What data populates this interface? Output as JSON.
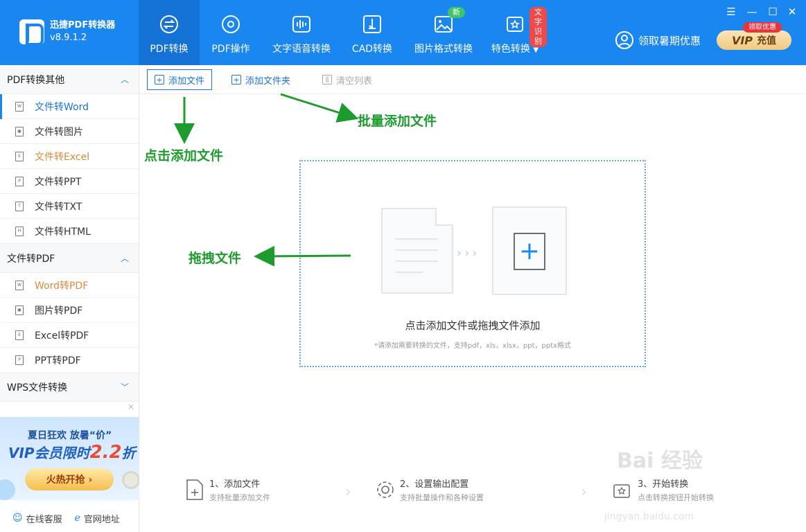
{
  "brand": {
    "name": "迅捷PDF转换器",
    "version": "v8.9.1.2"
  },
  "nav_tabs": [
    {
      "label": "PDF转换",
      "icon": "convert-icon"
    },
    {
      "label": "PDF操作",
      "icon": "settings-icon"
    },
    {
      "label": "文字语音转换",
      "icon": "audio-wave-icon"
    },
    {
      "label": "CAD转换",
      "icon": "cad-icon"
    },
    {
      "label": "图片格式转换",
      "icon": "image-icon",
      "badge": "新"
    },
    {
      "label": "特色转换",
      "icon": "special-icon",
      "badge": "文字识别"
    }
  ],
  "header": {
    "promo_label": "领取暑期优惠",
    "vip_tag": "领取优惠",
    "vip_word": "VIP",
    "vip_recharge": "充值"
  },
  "window_controls": {
    "menu": "☰",
    "minimize": "—",
    "maximize": "☐",
    "close": "✕"
  },
  "sidebar": {
    "groups": [
      {
        "title": "PDF转换其他",
        "expanded": true,
        "items": [
          {
            "label": "文件转Word",
            "glyph": "W",
            "state": "active"
          },
          {
            "label": "文件转图片",
            "glyph": "▣",
            "state": ""
          },
          {
            "label": "文件转Excel",
            "glyph": "E",
            "state": "orange"
          },
          {
            "label": "文件转PPT",
            "glyph": "P",
            "state": ""
          },
          {
            "label": "文件转TXT",
            "glyph": "T",
            "state": ""
          },
          {
            "label": "文件转HTML",
            "glyph": "H",
            "state": ""
          }
        ]
      },
      {
        "title": "文件转PDF",
        "expanded": true,
        "items": [
          {
            "label": "Word转PDF",
            "glyph": "W",
            "state": "orange"
          },
          {
            "label": "图片转PDF",
            "glyph": "▣",
            "state": ""
          },
          {
            "label": "Excel转PDF",
            "glyph": "E",
            "state": ""
          },
          {
            "label": "PPT转PDF",
            "glyph": "P",
            "state": ""
          }
        ]
      },
      {
        "title": "WPS文件转换",
        "expanded": false,
        "items": []
      }
    ],
    "ad": {
      "close": "×",
      "line1": "夏日狂欢 放暑“价”",
      "line2_prefix": "VIP会员限时",
      "line2_big": "2.2",
      "line2_suffix": "折",
      "button": "火热开抢 ›"
    },
    "footer": {
      "service": "在线客服",
      "website": "官网地址"
    }
  },
  "toolbar": {
    "add_file": "添加文件",
    "add_folder": "添加文件夹",
    "clear_list": "清空列表"
  },
  "dropzone": {
    "title": "点击添加文件或拖拽文件添加",
    "subtitle": "*请添加需要转换的文件，支持pdf，xls，xlsx，ppt，pptx格式",
    "arrows": "›››",
    "plus": "+"
  },
  "steps": [
    {
      "title": "1、添加文件",
      "desc": "支持批量添加文件"
    },
    {
      "title": "2、设置输出配置",
      "desc": "支持批量操作和各种设置"
    },
    {
      "title": "3、开始转换",
      "desc": "点击转换按钮开始转换"
    }
  ],
  "annotations": {
    "click_add": "点击添加文件",
    "batch_add": "批量添加文件",
    "drag": "拖拽文件"
  },
  "watermark": {
    "main": "Bai 经验",
    "sub": "jingyan.baidu.com"
  },
  "colors": {
    "primary": "#1a86f0",
    "annotation": "#1e9b2e",
    "active_tab": "#1572d6",
    "orange_text": "#d48a3a"
  }
}
